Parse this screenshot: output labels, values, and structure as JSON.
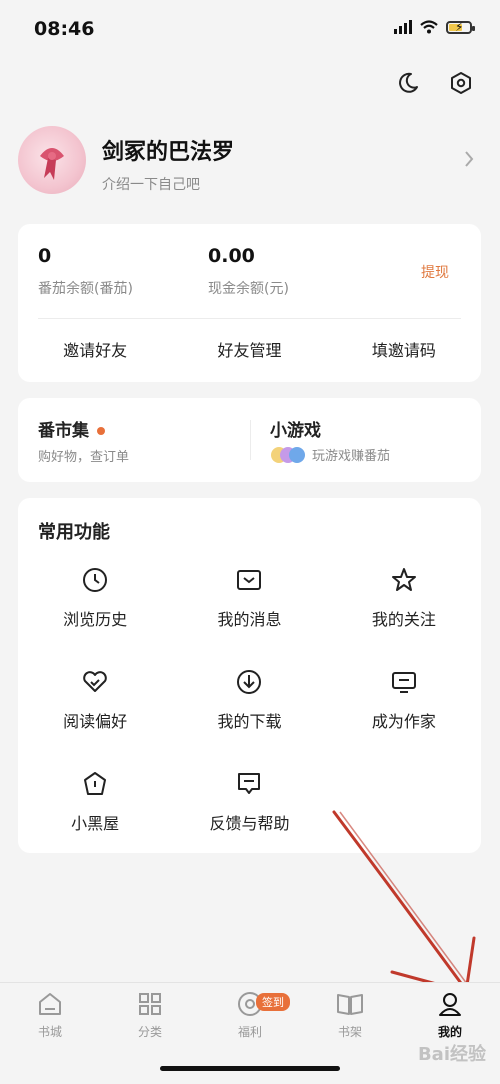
{
  "status_bar": {
    "time": "08:46"
  },
  "profile": {
    "name": "剑冢的巴法罗",
    "bio": "介绍一下自己吧"
  },
  "balance": {
    "tomato_value": "0",
    "tomato_label": "番茄余额(番茄)",
    "cash_value": "0.00",
    "cash_label": "现金余额(元)",
    "withdraw": "提现",
    "actions": [
      "邀请好友",
      "好友管理",
      "填邀请码"
    ]
  },
  "promo": {
    "market_title": "番市集",
    "market_sub": "购好物，查订单",
    "game_title": "小游戏",
    "game_sub": "玩游戏赚番茄"
  },
  "features": {
    "title": "常用功能",
    "items": [
      {
        "label": "浏览历史",
        "icon": "clock-icon"
      },
      {
        "label": "我的消息",
        "icon": "message-icon"
      },
      {
        "label": "我的关注",
        "icon": "star-icon"
      },
      {
        "label": "阅读偏好",
        "icon": "heart-icon"
      },
      {
        "label": "我的下载",
        "icon": "download-icon"
      },
      {
        "label": "成为作家",
        "icon": "writer-icon"
      },
      {
        "label": "小黑屋",
        "icon": "house-icon"
      },
      {
        "label": "反馈与帮助",
        "icon": "feedback-icon"
      }
    ]
  },
  "tabbar": {
    "items": [
      {
        "label": "书城",
        "icon": "bookstore-icon"
      },
      {
        "label": "分类",
        "icon": "category-icon"
      },
      {
        "label": "福利",
        "icon": "welfare-icon",
        "badge": "签到"
      },
      {
        "label": "书架",
        "icon": "bookshelf-icon"
      },
      {
        "label": "我的",
        "icon": "profile-icon",
        "active": true
      }
    ]
  },
  "watermark": "Bai经验",
  "colors": {
    "accent": "#e8703a",
    "background": "#f4f4f4",
    "card": "#ffffff",
    "annotation_arrow": "#c0392b"
  }
}
